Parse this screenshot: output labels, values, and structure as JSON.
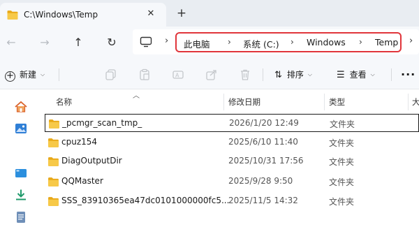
{
  "window": {
    "tab_title": "C:\\Windows\\Temp",
    "close_glyph": "✕",
    "new_tab_glyph": "+"
  },
  "nav": {
    "back": "←",
    "forward": "→",
    "up": "↑",
    "refresh": "↻"
  },
  "address": {
    "crumbs": [
      "此电脑",
      "系统 (C:)",
      "Windows",
      "Temp"
    ],
    "separator": "›",
    "highlight_color": "#e0353b"
  },
  "toolbar": {
    "new_label": "新建",
    "sort_label": "排序",
    "view_label": "查看",
    "more_label": "···",
    "icons": [
      "cut-icon",
      "copy-icon",
      "paste-icon",
      "rename-icon",
      "share-icon",
      "delete-icon"
    ]
  },
  "columns": {
    "name": "名称",
    "date": "修改日期",
    "type": "类型",
    "size": "大"
  },
  "rows": [
    {
      "name": "_pcmgr_scan_tmp_",
      "date": "2026/1/20 12:49",
      "type": "文件夹",
      "selected": true
    },
    {
      "name": "cpuz154",
      "date": "2025/6/10 11:40",
      "type": "文件夹"
    },
    {
      "name": "DiagOutputDir",
      "date": "2025/10/31 17:56",
      "type": "文件夹"
    },
    {
      "name": "QQMaster",
      "date": "2025/9/28 9:50",
      "type": "文件夹"
    },
    {
      "name": "SSS_83910365ea47dc0101000000fc5...",
      "date": "2025/11/5 14:32",
      "type": "文件夹"
    }
  ],
  "left_pane_icons": [
    "home-icon",
    "gallery-icon",
    "desktop-icon",
    "downloads-icon",
    "documents-icon"
  ],
  "colors": {
    "folder": "#f4c245",
    "accent": "#0a64c8"
  }
}
